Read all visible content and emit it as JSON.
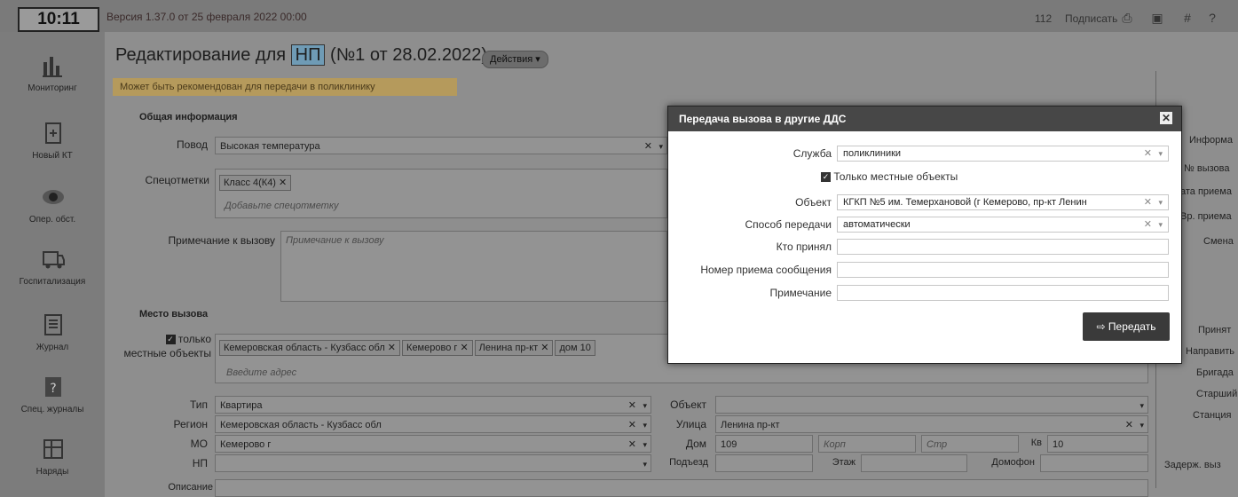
{
  "topbar": {
    "clock": "10:11",
    "version": "Версия 1.37.0 от 25 февраля 2022 00:00",
    "count": "112",
    "sign": "Подписать"
  },
  "sidebar": {
    "items": [
      {
        "label": "Мониторинг",
        "icon": "chart-icon"
      },
      {
        "label": "Новый КТ",
        "icon": "new-document-icon"
      },
      {
        "label": "Опер. обст.",
        "icon": "eye-icon"
      },
      {
        "label": "Госпитализация",
        "icon": "ambulance-icon"
      },
      {
        "label": "Журнал",
        "icon": "journal-icon"
      },
      {
        "label": "Спец. журналы",
        "icon": "help-journal-icon"
      },
      {
        "label": "Наряды",
        "icon": "tasks-icon"
      }
    ]
  },
  "header": {
    "title_prefix": "Редактирование для",
    "title_tag": "НП",
    "title_suffix": "(№1 от 28.02.2022)",
    "actions": "Действия"
  },
  "hint": "Может быть рекомендован для передачи в поликлинику",
  "form": {
    "section_general": "Общая информация",
    "povod_label": "Повод",
    "povod_value": "Высокая температура",
    "spec_label": "Спецотметки",
    "spec_chip": "Класс 4(К4)",
    "spec_placeholder": "Добавьте спецотметку",
    "note_label": "Примечание к вызову",
    "note_placeholder": "Примечание к вызову",
    "section_place": "Место вызова",
    "local_label_1": "только",
    "local_label_2": "местные объекты",
    "addr_chips": [
      "Кемеровская область - Кузбасс обл",
      "Кемерово г",
      "Ленина пр-кт",
      "дом 10"
    ],
    "addr_placeholder": "Введите адрес",
    "type_label": "Тип",
    "type_value": "Квартира",
    "region_label": "Регион",
    "region_value": "Кемеровская область - Кузбасс обл",
    "mo_label": "МО",
    "mo_value": "Кемерово г",
    "np_label": "НП",
    "np_value": "",
    "desc_label": "Описание",
    "object_label": "Объект",
    "street_label": "Улица",
    "street_value": "Ленина пр-кт",
    "house_label": "Дом",
    "house_value": "109",
    "korp_placeholder": "Корп",
    "str_placeholder": "Стр",
    "kv_label": "Кв",
    "kv_value": "10",
    "entrance_label": "Подъезд",
    "floor_label": "Этаж",
    "intercom_label": "Домофон"
  },
  "right_panel": {
    "items": [
      "Информа",
      "№ вызова",
      "ата приема",
      "Вр. приема",
      "Смена",
      "Принят",
      "Направить",
      "Бригада",
      "Старший",
      "Станция",
      "Задерж. выз"
    ]
  },
  "dialog": {
    "title": "Передача вызова в другие ДДС",
    "service_label": "Служба",
    "service_value": "поликлиники",
    "local_only": "Только местные объекты",
    "object_label": "Объект",
    "object_value": "КГКП №5 им. Темерхановой (г Кемерово, пр-кт Ленин",
    "method_label": "Способ передачи",
    "method_value": "автоматически",
    "who_label": "Кто принял",
    "msgnum_label": "Номер приема сообщения",
    "note_label": "Примечание",
    "send_button": "Передать"
  },
  "colors": {
    "overlay_bg": "#8e8e8e",
    "dialog_header": "#474747",
    "send_button": "#3a3a3a",
    "hint_bg": "#b59a5c",
    "tag_bg": "#6f9bb5"
  }
}
